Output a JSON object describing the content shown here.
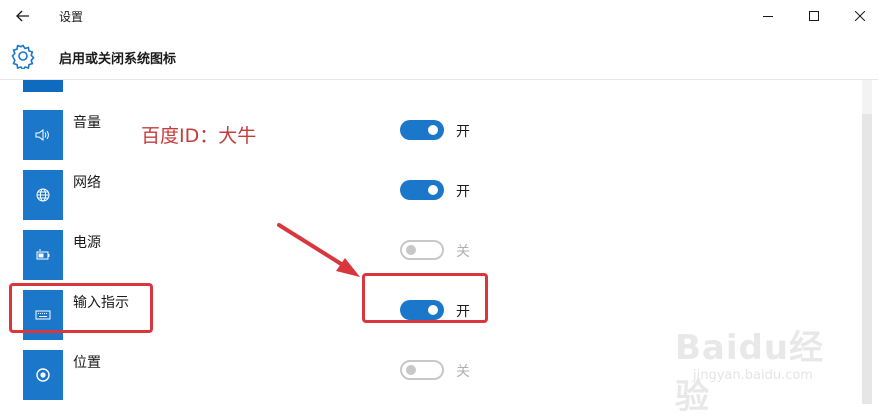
{
  "window": {
    "title": "设置"
  },
  "header": {
    "title": "启用或关闭系统图标"
  },
  "rows": [
    {
      "label": "音量",
      "icon": "volume-icon",
      "state": "开",
      "on": true
    },
    {
      "label": "网络",
      "icon": "network-icon",
      "state": "开",
      "on": true
    },
    {
      "label": "电源",
      "icon": "battery-icon",
      "state": "关",
      "on": false
    },
    {
      "label": "输入指示",
      "icon": "keyboard-icon",
      "state": "开",
      "on": true
    },
    {
      "label": "位置",
      "icon": "location-icon",
      "state": "关",
      "on": false
    }
  ],
  "annotation": {
    "text": "百度ID：大牛"
  },
  "watermark": {
    "logo": "Baidu经验",
    "url": "jingyan.baidu.com"
  },
  "colors": {
    "accent": "#1a77c9",
    "highlight": "#d9363e"
  }
}
